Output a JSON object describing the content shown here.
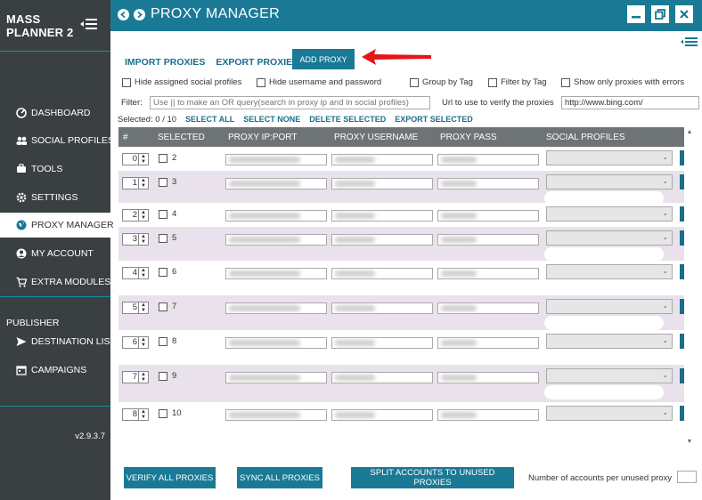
{
  "app": {
    "brand_line1": "MASS",
    "brand_line2": "PLANNER 2",
    "version": "v2.9.3.7"
  },
  "sidebar": {
    "items": [
      {
        "label": "DASHBOARD",
        "icon": "dashboard-icon"
      },
      {
        "label": "SOCIAL PROFILES",
        "icon": "users-icon"
      },
      {
        "label": "TOOLS",
        "icon": "tools-icon"
      },
      {
        "label": "SETTINGS",
        "icon": "gear-icon"
      },
      {
        "label": "PROXY MANAGER",
        "icon": "globe-icon"
      },
      {
        "label": "MY ACCOUNT",
        "icon": "user-icon"
      },
      {
        "label": "EXTRA MODULES",
        "icon": "cart-icon"
      }
    ],
    "publisher_heading": "PUBLISHER",
    "publisher_items": [
      {
        "label": "DESTINATION LISTS",
        "icon": "send-icon"
      },
      {
        "label": "CAMPAIGNS",
        "icon": "calendar-icon"
      }
    ]
  },
  "header": {
    "title": "PROXY MANAGER"
  },
  "actions": {
    "import": "IMPORT PROXIES",
    "export": "EXPORT PROXIES",
    "add": "ADD PROXY"
  },
  "options": {
    "hide_assigned": "Hide assigned social profiles",
    "hide_username": "Hide username and password",
    "group_by_tag": "Group by Tag",
    "filter_by_tag": "Filter by Tag",
    "only_errors": "Show only proxies with errors"
  },
  "filter": {
    "label": "Filter:",
    "placeholder": "Use || to make an OR query(search in proxy ip and in social profiles)",
    "verify_label": "Url to use to verify the proxies",
    "verify_url": "http://www.bing.com/"
  },
  "selection": {
    "label": "Selected:",
    "count": "0 / 10",
    "select_all": "SELECT ALL",
    "select_none": "SELECT NONE",
    "delete_selected": "DELETE SELECTED",
    "export_selected": "EXPORT SELECTED"
  },
  "table": {
    "columns": [
      "#",
      "SELECTED",
      "PROXY IP:PORT",
      "PROXY USERNAME",
      "PROXY PASS",
      "SOCIAL PROFILES"
    ],
    "rows": [
      {
        "index": "0",
        "number": "2"
      },
      {
        "index": "1",
        "number": "3"
      },
      {
        "index": "2",
        "number": "4"
      },
      {
        "index": "3",
        "number": "5"
      },
      {
        "index": "4",
        "number": "6"
      },
      {
        "index": "5",
        "number": "7"
      },
      {
        "index": "6",
        "number": "8"
      },
      {
        "index": "7",
        "number": "9"
      },
      {
        "index": "8",
        "number": "10"
      }
    ]
  },
  "bottom": {
    "verify_all": "VERIFY ALL PROXIES",
    "sync_all": "SYNC ALL PROXIES",
    "split": "SPLIT ACCOUNTS TO UNUSED PROXIES",
    "accounts_label": "Number of accounts per unused proxy"
  },
  "colors": {
    "accent": "#1a7a96",
    "sidebar": "#3a3f41",
    "table_header": "#6e7375",
    "row_alt": "#e9e1eb",
    "annotation_arrow": "#e8141b"
  }
}
